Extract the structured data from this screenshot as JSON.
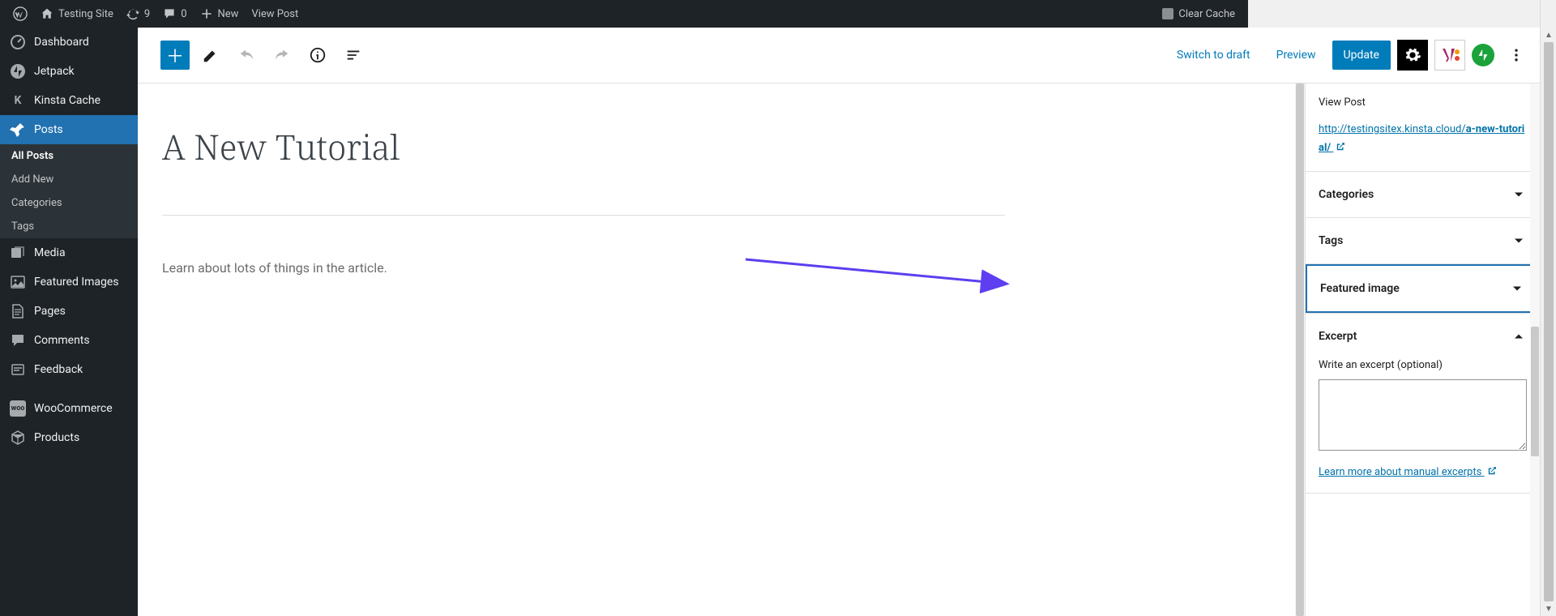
{
  "adminbar": {
    "site_name": "Testing Site",
    "updates_count": "9",
    "comments_count": "0",
    "new_label": "New",
    "view_post_label": "View Post",
    "clear_cache_label": "Clear Cache"
  },
  "sidebar": {
    "items": [
      {
        "label": "Dashboard",
        "icon": "dashboard"
      },
      {
        "label": "Jetpack",
        "icon": "jetpack"
      },
      {
        "label": "Kinsta Cache",
        "icon": "kinsta"
      },
      {
        "label": "Posts",
        "icon": "pin",
        "current": true,
        "sub": [
          "All Posts",
          "Add New",
          "Categories",
          "Tags"
        ],
        "sub_active": 0
      },
      {
        "label": "Media",
        "icon": "media"
      },
      {
        "label": "Featured Images",
        "icon": "featured"
      },
      {
        "label": "Pages",
        "icon": "page"
      },
      {
        "label": "Comments",
        "icon": "comments"
      },
      {
        "label": "Feedback",
        "icon": "feedback"
      },
      {
        "label": "WooCommerce",
        "icon": "woo"
      },
      {
        "label": "Products",
        "icon": "products"
      }
    ]
  },
  "topbar": {
    "switch_draft": "Switch to draft",
    "preview": "Preview",
    "update": "Update"
  },
  "post": {
    "title": "A New Tutorial",
    "body": "Learn about lots of things in the article."
  },
  "settings": {
    "view_post_label": "View Post",
    "permalink_prefix": "http://testingsitex.kinsta.cloud/",
    "permalink_slug": "a-new-tutorial/",
    "panels": {
      "categories": "Categories",
      "tags": "Tags",
      "featured_image": "Featured image",
      "excerpt": "Excerpt"
    },
    "excerpt": {
      "field_label": "Write an excerpt (optional)",
      "learn_more": "Learn more about manual excerpts"
    }
  },
  "annotation": {
    "arrow_color": "#5e3ef0"
  }
}
